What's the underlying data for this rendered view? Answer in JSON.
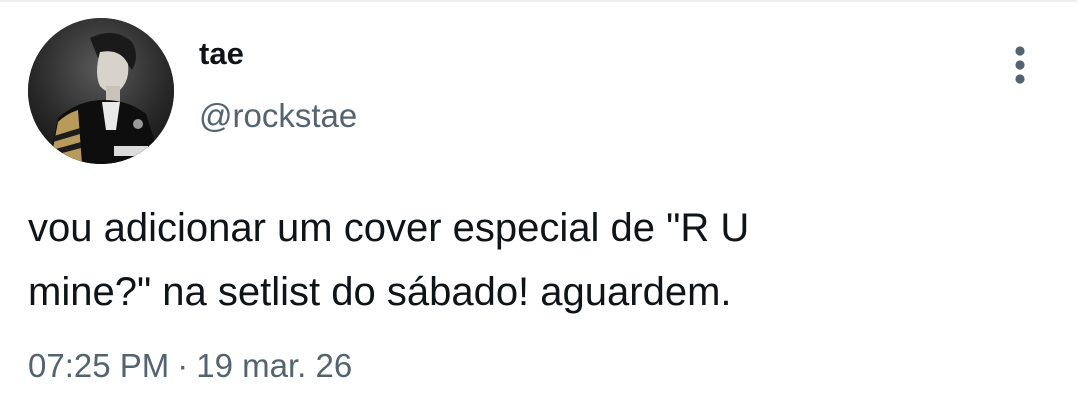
{
  "user": {
    "display_name": "tae",
    "handle": "@rockstae"
  },
  "tweet": {
    "text": "vou adicionar um cover especial de \"R U\nmine?\" na setlist do sábado! aguardem.",
    "time": "07:25 PM",
    "separator": "·",
    "date": "19 mar. 26"
  },
  "icons": {
    "more": "more-vertical-icon",
    "avatar": "profile-photo"
  },
  "colors": {
    "primary_text": "#0f1419",
    "secondary_text": "#536471",
    "background": "#ffffff"
  }
}
